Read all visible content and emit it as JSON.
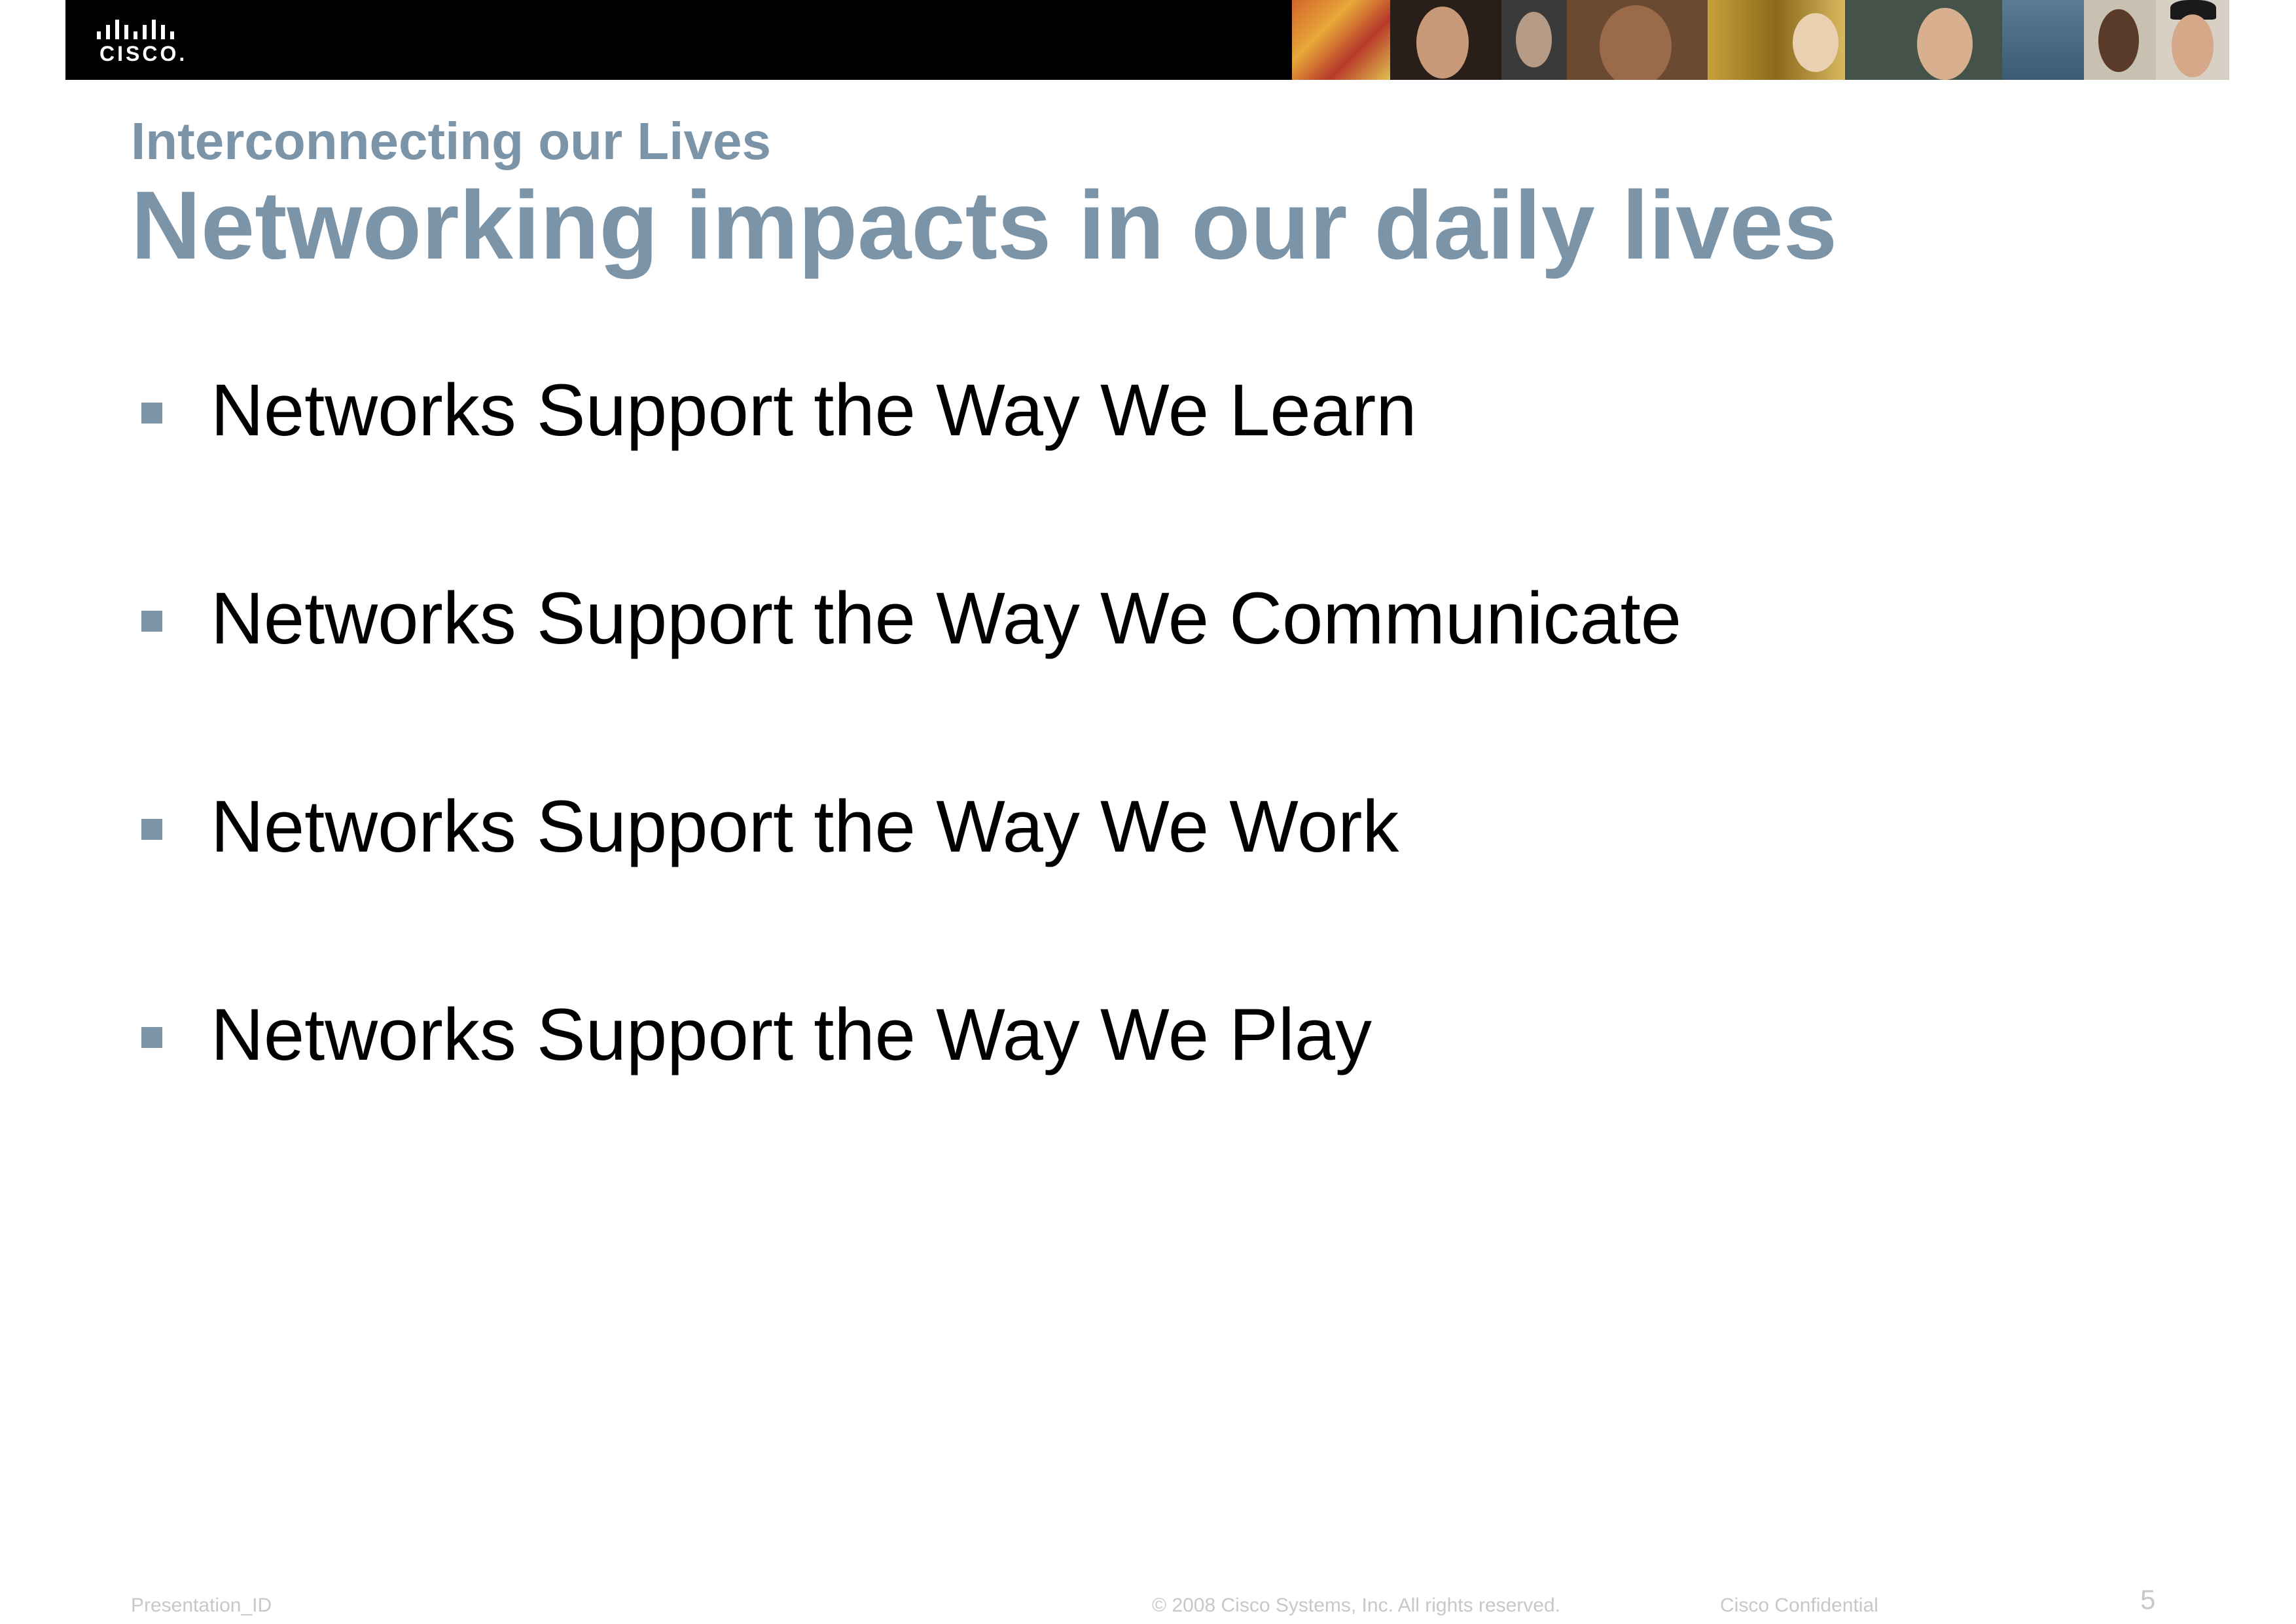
{
  "header": {
    "logo_text": "CISCO."
  },
  "slide": {
    "subtitle": "Interconnecting our Lives",
    "title": "Networking impacts in our daily lives",
    "bullets": [
      "Networks Support the Way We Learn",
      "Networks Support the Way We Communicate",
      "Networks Support the Way We Work",
      "Networks Support the Way We Play"
    ]
  },
  "footer": {
    "presentation_id": "Presentation_ID",
    "copyright": "© 2008 Cisco Systems, Inc. All rights reserved.",
    "confidential": "Cisco Confidential",
    "page_number": "5"
  },
  "colors": {
    "accent": "#7b94a8",
    "header_background": "#000000",
    "footer_text": "#c8c8c8"
  }
}
